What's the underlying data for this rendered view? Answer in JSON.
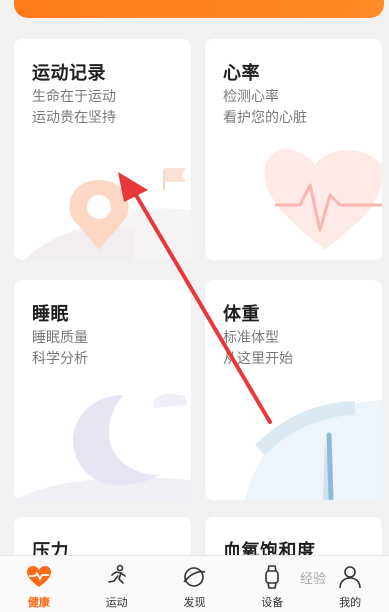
{
  "cards": {
    "exercise": {
      "title": "运动记录",
      "line1": "生命在于运动",
      "line2": "运动贵在坚持"
    },
    "heart": {
      "title": "心率",
      "line1": "检测心率",
      "line2": "看护您的心脏"
    },
    "sleep": {
      "title": "睡眠",
      "line1": "睡眠质量",
      "line2": "科学分析"
    },
    "weight": {
      "title": "体重",
      "line1": "标准体型",
      "line2": "从这里开始"
    },
    "pressure": {
      "title": "压力"
    },
    "spo2": {
      "title": "血氧饱和度"
    }
  },
  "tabs": [
    {
      "label": "健康",
      "icon": "heart-pulse-icon",
      "active": true
    },
    {
      "label": "运动",
      "icon": "running-icon",
      "active": false
    },
    {
      "label": "发现",
      "icon": "planet-icon",
      "active": false
    },
    {
      "label": "设备",
      "icon": "watch-icon",
      "active": false
    },
    {
      "label": "我的",
      "icon": "person-icon",
      "active": false
    }
  ],
  "watermark": "经验",
  "colors": {
    "accent": "#ff6a1a",
    "annotation_arrow": "#e8383b"
  }
}
